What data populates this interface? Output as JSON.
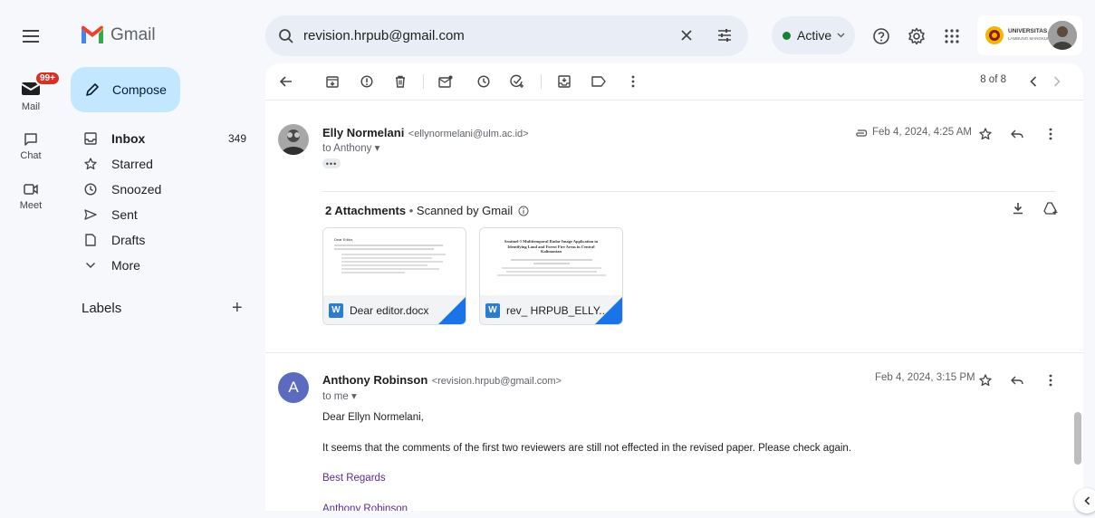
{
  "app": {
    "name": "Gmail"
  },
  "rail": {
    "items": [
      {
        "label": "Mail",
        "icon": "mail-icon",
        "badge": "99+"
      },
      {
        "label": "Chat",
        "icon": "chat-icon"
      },
      {
        "label": "Meet",
        "icon": "meet-icon"
      }
    ]
  },
  "compose": {
    "label": "Compose"
  },
  "nav": {
    "items": [
      {
        "label": "Inbox",
        "count": "349",
        "icon": "inbox-icon"
      },
      {
        "label": "Starred",
        "count": "",
        "icon": "star-icon"
      },
      {
        "label": "Snoozed",
        "count": "",
        "icon": "clock-icon"
      },
      {
        "label": "Sent",
        "count": "",
        "icon": "send-icon"
      },
      {
        "label": "Drafts",
        "count": "",
        "icon": "draft-icon"
      },
      {
        "label": "More",
        "count": "",
        "icon": "chevron-down-icon"
      }
    ],
    "labels_title": "Labels"
  },
  "search": {
    "value": "revision.hrpub@gmail.com"
  },
  "status": {
    "label": "Active"
  },
  "account": {
    "org": "UNIVERSITAS",
    "org_sub": "LAMBUNG MANGKURAT"
  },
  "toolbar": {
    "pager": "8 of 8"
  },
  "messages": [
    {
      "sender": "Elly Normelani",
      "email": "<ellynormelani@ulm.ac.id>",
      "to": "to Anthony",
      "date": "Feb 4, 2024, 4:25 AM",
      "attachments_count": "2 Attachments",
      "scanned": "Scanned by Gmail",
      "attachments": [
        {
          "name": "Dear editor.docx",
          "preview_title": "Dear Editor,"
        },
        {
          "name": "rev_ HRPUB_ELLY...",
          "preview_title": "Sentinel-1 Multitemporal Radar Image Application in Identifying Land and Forest Fire Areas in Central Kalimantan"
        }
      ]
    },
    {
      "sender": "Anthony Robinson",
      "email": "<revision.hrpub@gmail.com>",
      "to": "to me",
      "date": "Feb 4, 2024, 3:15 PM",
      "avatar_letter": "A",
      "body": {
        "greeting": "Dear Ellyn Normelani,",
        "text": "It seems that the comments of the first two reviewers are still not effected in the revised paper. Please check again.",
        "closing": "Best Regards",
        "signature": "Anthony Robinson"
      }
    }
  ],
  "colors": {
    "accent": "#1a73e8",
    "compose_bg": "#c2e7ff",
    "active_green": "#188038",
    "avatar_purple": "#5c6bc0"
  }
}
